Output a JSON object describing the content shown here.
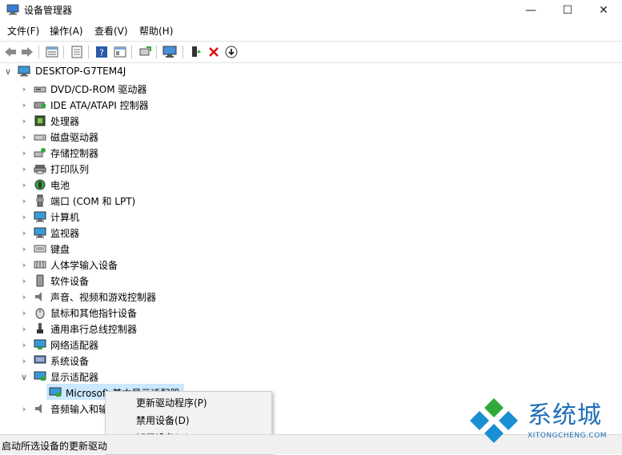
{
  "window": {
    "title": "设备管理器",
    "minimize_label": "—",
    "maximize_label": "☐",
    "close_label": "✕"
  },
  "menu": {
    "items": [
      "文件(F)",
      "操作(A)",
      "查看(V)",
      "帮助(H)"
    ]
  },
  "toolbar": {
    "buttons": [
      "back-icon",
      "forward-icon",
      "properties-icon",
      "show-hidden-icon",
      "help-icon",
      "view-icon",
      "update-driver-icon",
      "scan-hardware-icon",
      "enable-device-icon",
      "uninstall-icon",
      "download-icon"
    ]
  },
  "tree": {
    "root": "DESKTOP-G7TEM4J",
    "categories": [
      "DVD/CD-ROM 驱动器",
      "IDE ATA/ATAPI 控制器",
      "处理器",
      "磁盘驱动器",
      "存储控制器",
      "打印队列",
      "电池",
      "端口 (COM 和 LPT)",
      "计算机",
      "监视器",
      "键盘",
      "人体学输入设备",
      "软件设备",
      "声音、视频和游戏控制器",
      "鼠标和其他指针设备",
      "通用串行总线控制器",
      "网络适配器",
      "系统设备",
      "显示适配器"
    ],
    "expanded_child": "Microsoft 基本显示适配器",
    "last_category": "音频输入和输出"
  },
  "context_menu": {
    "items": [
      "更新驱动程序(P)",
      "禁用设备(D)",
      "卸载设备(U)"
    ]
  },
  "status": {
    "text": "启动所选设备的更新驱动"
  },
  "watermark": {
    "brand": "系统城",
    "site": "XITONGCHENG.COM"
  },
  "colors": {
    "selection": "#cce8ff",
    "watermark_blue": "#1f6fb8",
    "watermark_green": "#2eaa3a"
  }
}
